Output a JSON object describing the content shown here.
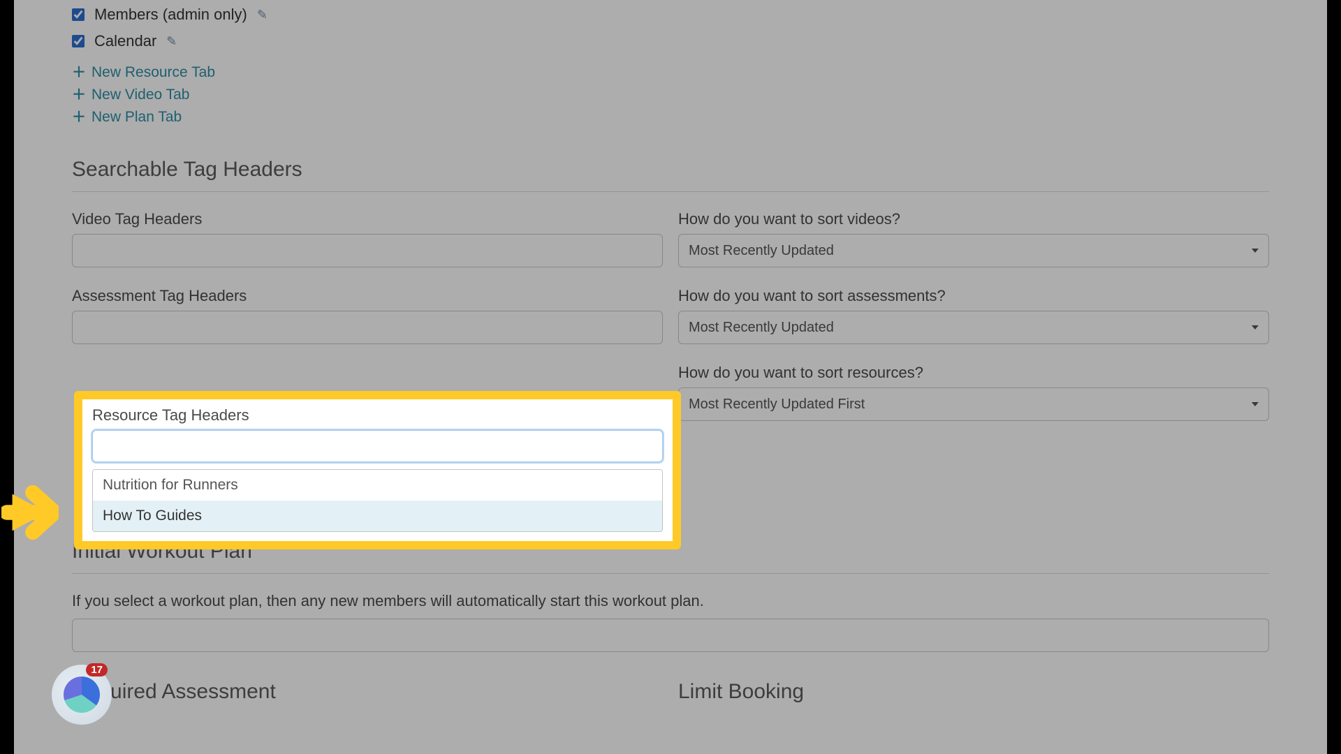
{
  "checkboxes": {
    "members_label": "Members (admin only)",
    "calendar_label": "Calendar"
  },
  "links": {
    "new_resource": "New Resource Tab",
    "new_video": "New Video Tab",
    "new_plan": "New Plan Tab"
  },
  "sections": {
    "searchable": "Searchable Tag Headers",
    "initial_plan": "Initial Workout Plan",
    "required_assessment": "Required Assessment",
    "limit_booking": "Limit Booking"
  },
  "fields": {
    "video_tag_label": "Video Tag Headers",
    "sort_videos_label": "How do you want to sort videos?",
    "sort_videos_value": "Most Recently Updated",
    "assessment_tag_label": "Assessment Tag Headers",
    "sort_assessments_label": "How do you want to sort assessments?",
    "sort_assessments_value": "Most Recently Updated",
    "resource_tag_label": "Resource Tag Headers",
    "sort_resources_label": "How do you want to sort resources?",
    "sort_resources_value": "Most Recently Updated First",
    "workout_help": "If you select a workout plan, then any new members will automatically start this workout plan."
  },
  "resource_tag_options": {
    "opt1": "Nutrition for Runners",
    "opt2": "How To Guides"
  },
  "widget": {
    "badge": "17"
  }
}
